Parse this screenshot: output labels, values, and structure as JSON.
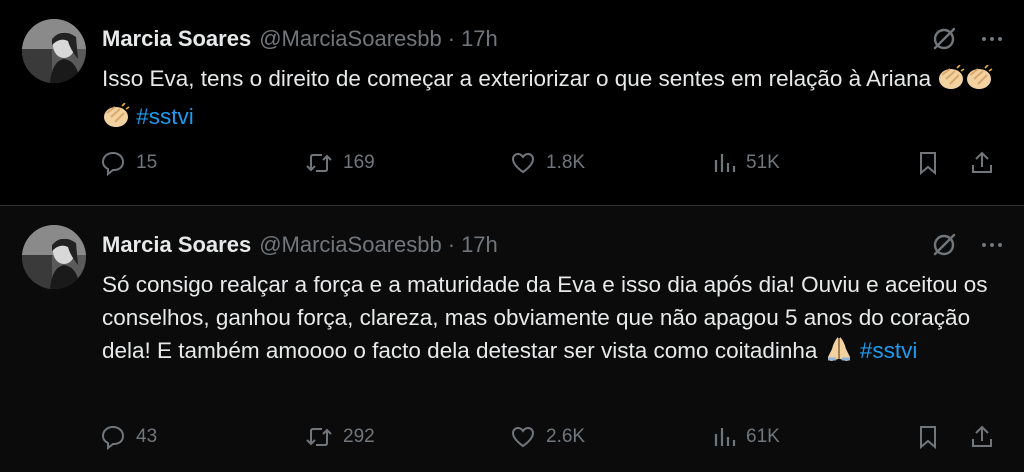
{
  "tweets": [
    {
      "author_name": "Marcia Soares",
      "handle": "@MarciaSoaresbb",
      "separator": "·",
      "time": "17h",
      "text_main": "Isso Eva, tens o direito de começar a exteriorizar o que sentes em relação à Ariana ",
      "emojis": [
        "clapping-hands",
        "clapping-hands",
        "clapping-hands"
      ],
      "hashtag": "#sstvi",
      "replies": "15",
      "reposts": "169",
      "likes": "1.8K",
      "views": "51K"
    },
    {
      "author_name": "Marcia Soares",
      "handle": "@MarciaSoaresbb",
      "separator": "·",
      "time": "17h",
      "text_main": "Só consigo realçar a força e a maturidade da Eva e isso dia após dia! Ouviu e aceitou  os conselhos, ganhou força, clareza, mas obviamente que não apagou 5 anos do coração dela!  E também amoooo o facto dela detestar ser vista como coitadinha ",
      "emojis": [
        "folded-hands"
      ],
      "hashtag": "#sstvi",
      "replies": "43",
      "reposts": "292",
      "likes": "2.6K",
      "views": "61K"
    }
  ],
  "colors": {
    "background": "#000000",
    "text": "#e7e9ea",
    "secondary": "#71767b",
    "hashtag": "#1d9bf0",
    "divider": "#2f3336"
  }
}
